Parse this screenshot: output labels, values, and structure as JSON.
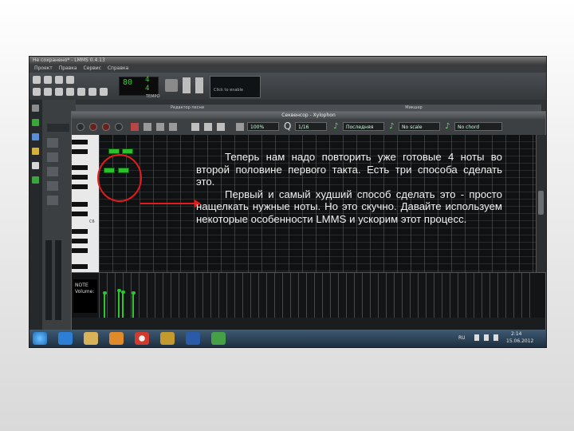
{
  "window": {
    "title": "Не сохранено* - LMMS 0.4.13"
  },
  "menu": [
    "Проект",
    "Правка",
    "Сервис",
    "Справка"
  ],
  "toolbar": {
    "tempo": "80",
    "time_sig_top": "4",
    "time_sig_bottom": "4",
    "tempo_label": "TEMPO",
    "click_hint": "Click to enable"
  },
  "song_window_title": "Редактор песни",
  "fx_window_title": "Микшер",
  "piano_roll": {
    "title": "Секвенсор - Xylophon",
    "zoom": "100%",
    "quantize": "1/16",
    "note_len": "Последняя",
    "scale": "No scale",
    "chord": "No chord",
    "key_label": "C6"
  },
  "velocity_panel": {
    "label_line1": "NOTE",
    "label_line2": "Volume:"
  },
  "velocity_levels": [
    0.55,
    0.6,
    0.58,
    0.55
  ],
  "overlay_text": {
    "paragraph1": "Теперь нам надо повторить уже готовые 4 ноты во второй половине первого такта. Есть три способа сделать это.",
    "paragraph2": "Первый и самый худший способ сделать это - просто нащелкать нужные ноты. Но это скучно. Давайте используем некоторые особенности LMMS и ускорим этот процесс."
  },
  "taskbar": {
    "lang": "RU",
    "time": "2:14",
    "date": "15.06.2012",
    "apps": [
      "start",
      "ie",
      "explorer",
      "media",
      "chrome",
      "winamp",
      "word",
      "lmms"
    ]
  },
  "colors": {
    "note": "#27c227",
    "highlight": "#e21c1c",
    "text": "#f2f2f2"
  }
}
